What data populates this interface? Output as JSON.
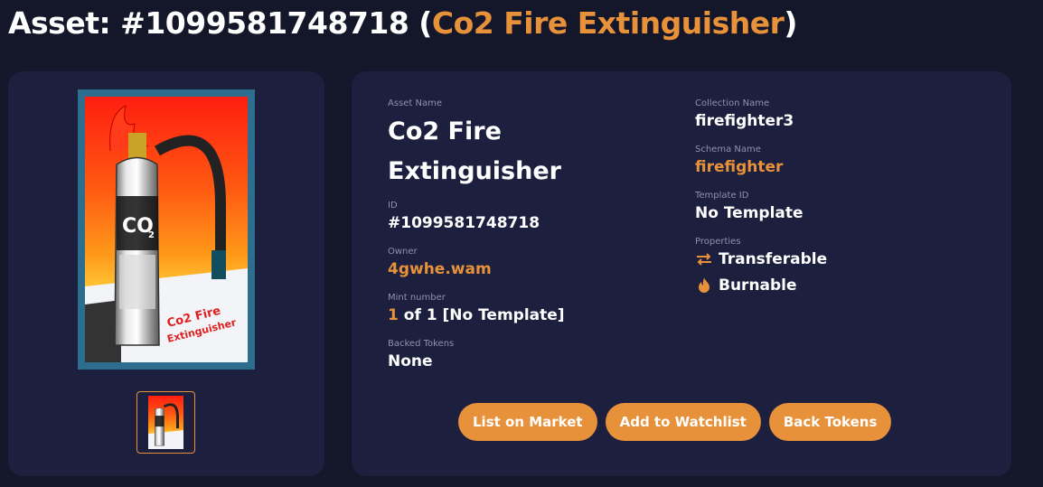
{
  "header": {
    "prefix": "Asset: #1099581748718 (",
    "name": "Co2 Fire Extinguisher",
    "suffix": ")"
  },
  "image": {
    "caption_line1": "Co2 Fire",
    "caption_line2": "Extinguisher",
    "co2_text": "CO",
    "co2_sub": "2"
  },
  "details": {
    "asset_name_label": "Asset Name",
    "asset_name": "Co2 Fire Extinguisher",
    "id_label": "ID",
    "id": "#1099581748718",
    "owner_label": "Owner",
    "owner": "4gwhe.wam",
    "mint_label": "Mint number",
    "mint_number": "1",
    "mint_rest": " of 1 [No Template]",
    "backed_label": "Backed Tokens",
    "backed": "None",
    "collection_label": "Collection Name",
    "collection": "firefighter3",
    "schema_label": "Schema Name",
    "schema": "firefighter",
    "template_label": "Template ID",
    "template": "No Template",
    "properties_label": "Properties",
    "properties": [
      {
        "label": "Transferable",
        "icon": "transfer-arrows-icon"
      },
      {
        "label": "Burnable",
        "icon": "flame-icon"
      }
    ]
  },
  "actions": {
    "list_on_market": "List on Market",
    "add_to_watchlist": "Add to Watchlist",
    "back_tokens": "Back Tokens"
  },
  "colors": {
    "accent": "#e8913b",
    "background": "#141629",
    "card": "#1c1f3d",
    "muted_label": "#8e92ad"
  }
}
